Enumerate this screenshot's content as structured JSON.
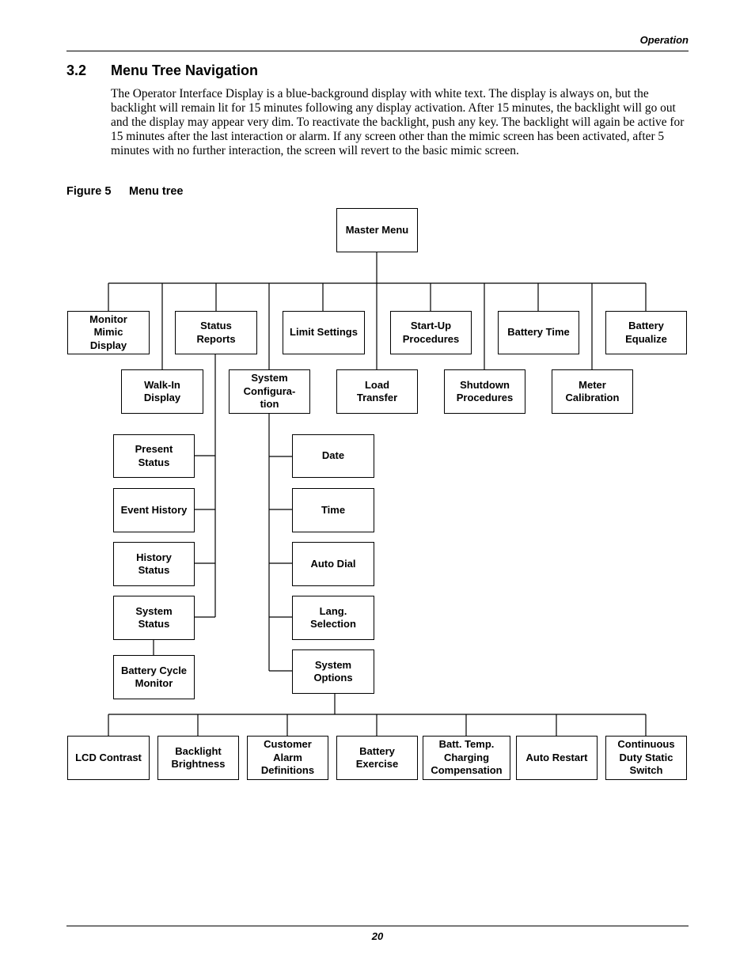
{
  "header": {
    "running_title": "Operation"
  },
  "section": {
    "number": "3.2",
    "title": "Menu Tree Navigation",
    "body": "The Operator Interface Display is a blue-background display with white text. The display is always on, but the backlight will remain lit for 15 minutes following any display activation. After 15 minutes, the backlight will go out and the display may appear very dim. To reactivate the backlight, push any key. The backlight will again be active for 15 minutes after the last interaction or alarm. If any screen other than the mimic screen has been activated, after 5 minutes with no further interaction, the screen will revert to the basic mimic screen."
  },
  "figure": {
    "label": "Figure 5",
    "title": "Menu tree",
    "root": "Master Menu",
    "top_level": [
      "Monitor\nMimic\nDisplay",
      "Walk-In\nDisplay",
      "Status\nReports",
      "System\nConfigura-\ntion",
      "Limit Settings",
      "Load\nTransfer",
      "Start-Up\nProcedures",
      "Shutdown\nProcedures",
      "Battery Time",
      "Meter\nCalibration",
      "Battery\nEqualize"
    ],
    "status_reports_children": [
      "Present\nStatus",
      "Event History",
      "History\nStatus",
      "System\nStatus"
    ],
    "system_status_child": "Battery Cycle\nMonitor",
    "system_configuration_children": [
      "Date",
      "Time",
      "Auto Dial",
      "Lang.\nSelection",
      "System\nOptions"
    ],
    "system_options_children": [
      "LCD Contrast",
      "Backlight\nBrightness",
      "Customer\nAlarm\nDefinitions",
      "Battery\nExercise",
      "Batt. Temp.\nCharging\nCompensation",
      "Auto Restart",
      "Continuous\nDuty Static\nSwitch"
    ]
  },
  "footer": {
    "page_number": "20"
  }
}
